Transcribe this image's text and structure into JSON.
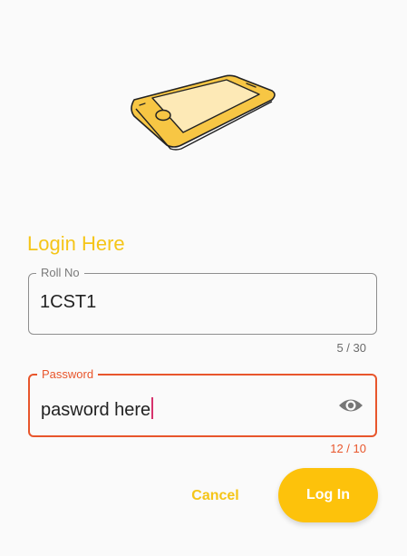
{
  "header": {
    "illustration_icon": "smartphone-illustration"
  },
  "form": {
    "title": "Login Here",
    "roll": {
      "label": "Roll No",
      "value": "1CST1",
      "counter": "5 / 30"
    },
    "password": {
      "label": "Password",
      "value": "pasword here",
      "counter": "12 / 10",
      "toggle_icon": "eye-icon"
    },
    "cancel_label": "Cancel",
    "login_label": "Log In"
  },
  "colors": {
    "accent": "#fdc20b",
    "title": "#f5c518",
    "error": "#e8562c"
  }
}
